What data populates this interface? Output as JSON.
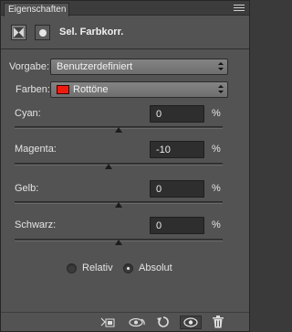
{
  "panel": {
    "tab_title": "Eigenschaften",
    "adjustment_title": "Sel. Farbkorr."
  },
  "preset": {
    "label": "Vorgabe:",
    "value": "Benutzerdefiniert"
  },
  "colors": {
    "label": "Farben:",
    "value": "Rottöne",
    "swatch_color": "#ee1c0e"
  },
  "sliders": [
    {
      "label": "Cyan:",
      "value": "0",
      "unit": "%",
      "level": 0
    },
    {
      "label": "Magenta:",
      "value": "-10",
      "unit": "%",
      "level": -10
    },
    {
      "label": "Gelb:",
      "value": "0",
      "unit": "%",
      "level": 0
    },
    {
      "label": "Schwarz:",
      "value": "0",
      "unit": "%",
      "level": 0
    }
  ],
  "method": {
    "relative_label": "Relativ",
    "absolute_label": "Absolut",
    "selected": "absolute"
  },
  "footer": {
    "icons": [
      "clip-to-layer-icon",
      "view-previous-state-icon",
      "reset-icon",
      "visibility-eye-icon",
      "trash-icon"
    ]
  }
}
